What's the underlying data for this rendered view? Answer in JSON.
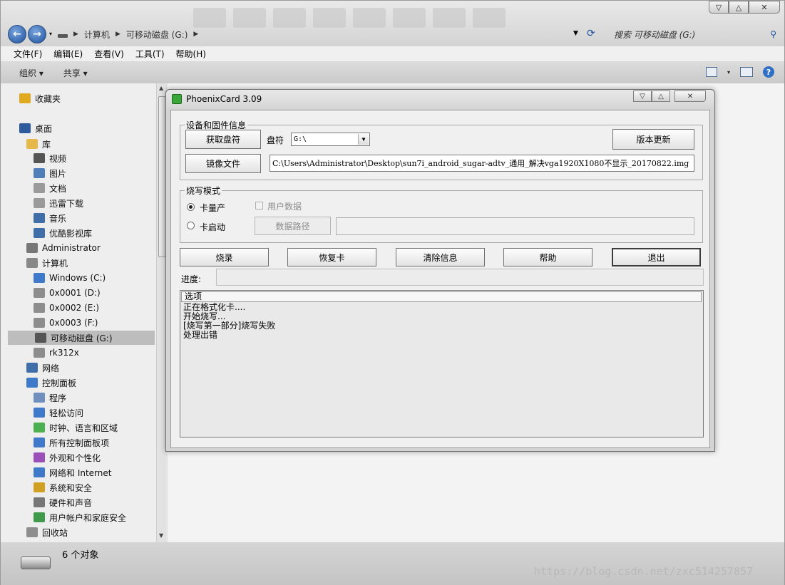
{
  "window": {
    "caption_buttons": {
      "minimize": "▽",
      "maximize": "△",
      "close": "✕"
    }
  },
  "address_bar": {
    "back_icon": "back-arrow-icon",
    "forward_icon": "forward-arrow-icon",
    "crumbs": [
      "计算机",
      "可移动磁盘 (G:)"
    ],
    "search_placeholder": "搜索 可移动磁盘 (G:)"
  },
  "menu": [
    "文件(F)",
    "编辑(E)",
    "查看(V)",
    "工具(T)",
    "帮助(H)"
  ],
  "toolbar": {
    "organize": "组织 ▾",
    "share": "共享 ▾"
  },
  "nav": {
    "items": [
      {
        "label": "收藏夹",
        "icon": "star-icon",
        "color": "#e0a91e"
      },
      {
        "label": "桌面",
        "icon": "desktop-icon",
        "color": "#2d5b9e"
      },
      {
        "label": "库",
        "icon": "library-icon",
        "color": "#e6b84a"
      },
      {
        "label": "视频",
        "icon": "video-icon",
        "color": "#555555"
      },
      {
        "label": "图片",
        "icon": "picture-icon",
        "color": "#4f7fb8"
      },
      {
        "label": "文档",
        "icon": "document-icon",
        "color": "#9a9a9a"
      },
      {
        "label": "迅雷下载",
        "icon": "download-folder-icon",
        "color": "#9a9a9a"
      },
      {
        "label": "音乐",
        "icon": "music-icon",
        "color": "#3f6ea8"
      },
      {
        "label": "优酷影视库",
        "icon": "video-library-icon",
        "color": "#3f6ea8"
      },
      {
        "label": "Administrator",
        "icon": "user-icon",
        "color": "#777777"
      },
      {
        "label": "计算机",
        "icon": "computer-icon",
        "color": "#888888"
      },
      {
        "label": "Windows (C:)",
        "icon": "windows-drive-icon",
        "color": "#3f79c9"
      },
      {
        "label": "0x0001 (D:)",
        "icon": "drive-icon",
        "color": "#8d8d8d"
      },
      {
        "label": "0x0002 (E:)",
        "icon": "drive-icon",
        "color": "#8d8d8d"
      },
      {
        "label": "0x0003 (F:)",
        "icon": "drive-icon",
        "color": "#8d8d8d"
      },
      {
        "label": "可移动磁盘 (G:)",
        "icon": "removable-drive-icon",
        "color": "#555555"
      },
      {
        "label": "rk312x",
        "icon": "device-icon",
        "color": "#8d8d8d"
      },
      {
        "label": "网络",
        "icon": "network-icon",
        "color": "#3f6ea8"
      },
      {
        "label": "控制面板",
        "icon": "control-panel-icon",
        "color": "#3f79c9"
      },
      {
        "label": "程序",
        "icon": "programs-icon",
        "color": "#6f8fbf"
      },
      {
        "label": "轻松访问",
        "icon": "accessibility-icon",
        "color": "#3f79c9"
      },
      {
        "label": "时钟、语言和区域",
        "icon": "clock-icon",
        "color": "#4caf50"
      },
      {
        "label": "所有控制面板项",
        "icon": "control-panel-icon",
        "color": "#3f79c9"
      },
      {
        "label": "外观和个性化",
        "icon": "appearance-icon",
        "color": "#9b4fb8"
      },
      {
        "label": "网络和 Internet",
        "icon": "network-internet-icon",
        "color": "#3f79c9"
      },
      {
        "label": "系统和安全",
        "icon": "security-icon",
        "color": "#d0a020"
      },
      {
        "label": "硬件和声音",
        "icon": "hardware-icon",
        "color": "#777777"
      },
      {
        "label": "用户帐户和家庭安全",
        "icon": "users-icon",
        "color": "#3f9a4a"
      },
      {
        "label": "回收站",
        "icon": "recycle-bin-icon",
        "color": "#8d8d8d"
      }
    ]
  },
  "status": {
    "count": "6 个对象",
    "watermark": "https://blog.csdn.net/zxc514257857"
  },
  "dialog": {
    "title": "PhoenixCard 3.09",
    "group_device": "设备和固件信息",
    "btn_get_drive": "获取盘符",
    "label_drive": "盘符",
    "drive_value": "G:\\",
    "btn_update": "版本更新",
    "btn_image": "镜像文件",
    "image_path": "C:\\Users\\Administrator\\Desktop\\sun7i_android_sugar-adtv_通用_解决vga1920X1080不显示_20170822.img",
    "group_mode": "烧写模式",
    "radio_mass": "卡量产",
    "radio_boot": "卡启动",
    "check_userdata": "用户数据",
    "btn_datapath": "数据路径",
    "btn_burn": "烧录",
    "btn_restore": "恢复卡",
    "btn_clear": "清除信息",
    "btn_help": "帮助",
    "btn_exit": "退出",
    "label_progress": "进度:",
    "log_header": "选项",
    "log_lines": [
      "正在格式化卡....",
      "开始烧写...",
      "[烧写第一部分]烧写失败",
      "处理出错"
    ]
  }
}
